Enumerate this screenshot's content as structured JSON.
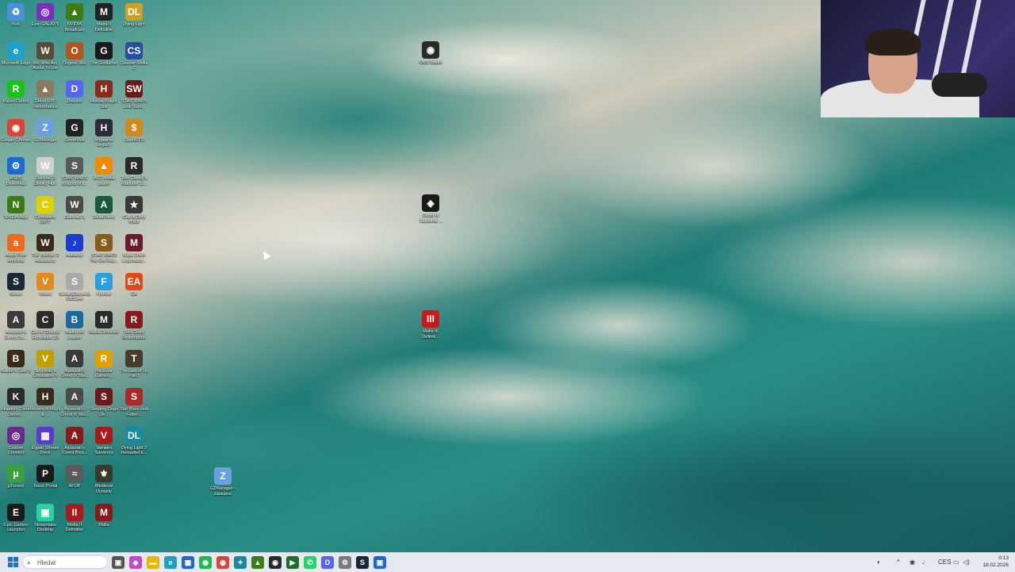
{
  "desktop_icons": [
    {
      "label": "Koš",
      "icon": "recycle-bin-icon",
      "color": "#4a90d9",
      "glyph": "♻"
    },
    {
      "label": "Epic GALAXY",
      "icon": "gog-galaxy-icon",
      "color": "#7b2fbf",
      "glyph": "◎"
    },
    {
      "label": "NVIDIA Broadcast",
      "icon": "nvidia-broadcast-icon",
      "color": "#3b7d12",
      "glyph": "▲"
    },
    {
      "label": "Mafia II Definitive",
      "icon": "mafia-icon",
      "color": "#222222",
      "glyph": "M"
    },
    {
      "label": "Dying Light",
      "icon": "dying-light-icon",
      "color": "#c9a227",
      "glyph": "DL"
    },
    {
      "label": "Microsoft Edge",
      "icon": "edge-icon",
      "color": "#1fa0c8",
      "glyph": "e"
    },
    {
      "label": "We Who Are About To Die",
      "icon": "game-icon",
      "color": "#5a4a3a",
      "glyph": "W"
    },
    {
      "label": "Original War",
      "icon": "original-war-icon",
      "color": "#b5541c",
      "glyph": "O"
    },
    {
      "label": "The Godfather",
      "icon": "godfather-icon",
      "color": "#1a1a1a",
      "glyph": "G"
    },
    {
      "label": "Counter-Strike 2",
      "icon": "cs2-icon",
      "color": "#2a4fa0",
      "glyph": "CS"
    },
    {
      "label": "Razer Cortex",
      "icon": "razer-cortex-icon",
      "color": "#19c31b",
      "glyph": "R"
    },
    {
      "label": "Ghost EPF Performance",
      "icon": "game-icon",
      "color": "#8a7a60",
      "glyph": "▲"
    },
    {
      "label": "Discord",
      "icon": "discord-icon",
      "color": "#5865f2",
      "glyph": "D"
    },
    {
      "label": "Hollow Knight Silk",
      "icon": "game-icon",
      "color": "#8a2a1a",
      "glyph": "H"
    },
    {
      "label": "STAR WARS Jedi Surv...",
      "icon": "star-wars-icon",
      "color": "#6a1a1a",
      "glyph": "SW"
    },
    {
      "label": "Google Chrome",
      "icon": "chrome-icon",
      "color": "#db4437",
      "glyph": "◉"
    },
    {
      "label": "GZManager",
      "icon": "gzmanager-icon",
      "color": "#6aa0e0",
      "glyph": "Z"
    },
    {
      "label": "GeeerHub",
      "icon": "game-icon",
      "color": "#222222",
      "glyph": "G"
    },
    {
      "label": "Hogwarts Legacy",
      "icon": "hogwarts-icon",
      "color": "#2a2a3a",
      "glyph": "H"
    },
    {
      "label": "OpenRTD",
      "icon": "openttd-icon",
      "color": "#d08a20",
      "glyph": "$"
    },
    {
      "label": "ASUS DriverHub",
      "icon": "asus-icon",
      "color": "#1a6ad0",
      "glyph": "⚙"
    },
    {
      "label": "Zaklínač 3 Divoký Hon",
      "icon": "witcher-icon",
      "color": "#d0d0d0",
      "glyph": "W"
    },
    {
      "label": "STAR WARS Knights of t...",
      "icon": "star-wars-icon",
      "color": "#5a5a5a",
      "glyph": "S"
    },
    {
      "label": "VLC media player",
      "icon": "vlc-icon",
      "color": "#f08a00",
      "glyph": "▲"
    },
    {
      "label": "Tom Clancy's Rainbow Si...",
      "icon": "rainbow-six-icon",
      "color": "#2a2a2a",
      "glyph": "R"
    },
    {
      "label": "NVIDIA App",
      "icon": "nvidia-icon",
      "color": "#3b7d12",
      "glyph": "N"
    },
    {
      "label": "Cyberpunk 2077",
      "icon": "cyberpunk-icon",
      "color": "#e0d000",
      "glyph": "C"
    },
    {
      "label": "Zaklínač 1",
      "icon": "witcher-icon",
      "color": "#4a4a4a",
      "glyph": "W"
    },
    {
      "label": "DeltaForce",
      "icon": "delta-force-icon",
      "color": "#1a5a3a",
      "glyph": "A"
    },
    {
      "label": "Call of Duty WWII",
      "icon": "cod-icon",
      "color": "#3a3a3a",
      "glyph": "★"
    },
    {
      "label": "Avast Free Antivirus",
      "icon": "avast-icon",
      "color": "#f06a1a",
      "glyph": "a"
    },
    {
      "label": "The Witcher 2 Assassins",
      "icon": "witcher-icon",
      "color": "#3a2a1a",
      "glyph": "W"
    },
    {
      "label": "Audacity",
      "icon": "audacity-icon",
      "color": "#1a3ad0",
      "glyph": "♪"
    },
    {
      "label": "STAR WARS The Old Rep...",
      "icon": "star-wars-icon",
      "color": "#8a5a1a",
      "glyph": "S"
    },
    {
      "label": "Mass Effect Legendary...",
      "icon": "mass-effect-icon",
      "color": "#6a1a2a",
      "glyph": "M"
    },
    {
      "label": "Steam",
      "icon": "steam-icon",
      "color": "#1b2838",
      "glyph": "S"
    },
    {
      "label": "Vortex",
      "icon": "vortex-icon",
      "color": "#e08a20",
      "glyph": "V"
    },
    {
      "label": "StreamElements OBS.live",
      "icon": "streamelements-icon",
      "color": "#aaaaaa",
      "glyph": "S"
    },
    {
      "label": "Fortnite",
      "icon": "fortnite-icon",
      "color": "#2aa0e0",
      "glyph": "F"
    },
    {
      "label": "EA",
      "icon": "ea-icon",
      "color": "#e04a1a",
      "glyph": "EA"
    },
    {
      "label": "Assassin's Creed Ori...",
      "icon": "assassins-creed-icon",
      "color": "#3a3a3a",
      "glyph": "A"
    },
    {
      "label": "Call of Cthulhu Expedition 33",
      "icon": "game-icon",
      "color": "#2a2a2a",
      "glyph": "C"
    },
    {
      "label": "Battle.net Loader",
      "icon": "battlenet-icon",
      "color": "#1a6aa0",
      "glyph": "B"
    },
    {
      "label": "Mafia Definitive",
      "icon": "mafia-icon",
      "color": "#2a2a2a",
      "glyph": "M"
    },
    {
      "label": "Red Dead Redemption",
      "icon": "rdr-icon",
      "color": "#8a1a1a",
      "glyph": "R"
    },
    {
      "label": "Baldur's Gate 3",
      "icon": "baldurs-gate-icon",
      "color": "#3a2a1a",
      "glyph": "B"
    },
    {
      "label": "Sid Meier's Civilization V",
      "icon": "civilization-icon",
      "color": "#c0a000",
      "glyph": "V"
    },
    {
      "label": "Assassin's Creed IV Bla...",
      "icon": "assassins-creed-icon",
      "color": "#3a3a3a",
      "glyph": "A"
    },
    {
      "label": "Rockstar Games...",
      "icon": "rockstar-icon",
      "color": "#e0a000",
      "glyph": "R"
    },
    {
      "label": "The Last of Us Part I",
      "icon": "last-of-us-icon",
      "color": "#4a3a2a",
      "glyph": "T"
    },
    {
      "label": "Kingdom Come Delive...",
      "icon": "kingdom-come-icon",
      "color": "#2a2a2a",
      "glyph": "K"
    },
    {
      "label": "Heroes of Might & ...",
      "icon": "heroes-icon",
      "color": "#3a2a1a",
      "glyph": "H"
    },
    {
      "label": "Assassin's Creed IV Bla...",
      "icon": "assassins-creed-icon",
      "color": "#4a4a4a",
      "glyph": "A"
    },
    {
      "label": "Sleeping Dogs De...",
      "icon": "sleeping-dogs-icon",
      "color": "#6a1a1a",
      "glyph": "S"
    },
    {
      "label": "Star Wars Jedi Fallen...",
      "icon": "star-wars-icon",
      "color": "#aa2a2a",
      "glyph": "S"
    },
    {
      "label": "Custom Connect",
      "icon": "connect-icon",
      "color": "#6a2a8a",
      "glyph": "◎"
    },
    {
      "label": "Elgato Stream Deck",
      "icon": "stream-deck-icon",
      "color": "#5a3ad0",
      "glyph": "▦"
    },
    {
      "label": "Assassin's Creed Brot...",
      "icon": "assassins-creed-icon",
      "color": "#8a1a1a",
      "glyph": "A"
    },
    {
      "label": "Vampire Survivors",
      "icon": "vampire-survivors-icon",
      "color": "#aa1a1a",
      "glyph": "V"
    },
    {
      "label": "Dying Light 2 Reloaded E...",
      "icon": "dying-light-icon",
      "color": "#1a8aa0",
      "glyph": "DL"
    },
    {
      "label": "µTorrent",
      "icon": "utorrent-icon",
      "color": "#3aa03a",
      "glyph": "µ"
    },
    {
      "label": "Touch Portal",
      "icon": "touch-portal-icon",
      "color": "#1a1a1a",
      "glyph": "P"
    },
    {
      "label": "AFOP",
      "icon": "afop-icon",
      "color": "#5a5a5a",
      "glyph": "≈"
    },
    {
      "label": "Medieval Dynasty",
      "icon": "medieval-dynasty-icon",
      "color": "#3a3a2a",
      "glyph": "⚜"
    },
    {
      "label": "",
      "icon": "blank-icon",
      "color": "#00000000",
      "glyph": ""
    },
    {
      "label": "Epic Games Launcher",
      "icon": "epic-games-icon",
      "color": "#1a1a1a",
      "glyph": "E"
    },
    {
      "label": "Streamlabs Desktop",
      "icon": "streamlabs-icon",
      "color": "#2ad0a0",
      "glyph": "▣"
    },
    {
      "label": "Mafia II Definitive",
      "icon": "mafia-icon",
      "color": "#aa1a1a",
      "glyph": "II"
    },
    {
      "label": "Mafia",
      "icon": "mafia-icon",
      "color": "#8a1a1a",
      "glyph": "M"
    }
  ],
  "loose_icons": [
    {
      "label": "OBS Studio",
      "icon": "obs-studio-icon",
      "color": "#2a2a2a",
      "glyph": "◉"
    },
    {
      "label": "Ghost of Tsushima ...",
      "icon": "ghost-of-tsushima-icon",
      "color": "#1a1a1a",
      "glyph": "◈"
    },
    {
      "label": "Mafia III Definiti...",
      "icon": "mafia-iii-icon",
      "color": "#c81a1a",
      "glyph": "III"
    },
    {
      "label": "GZManager - zástupce",
      "icon": "gzmanager-icon",
      "color": "#6aa0e0",
      "glyph": "Z"
    }
  ],
  "taskbar": {
    "search_placeholder": "Hledat",
    "apps": [
      {
        "name": "task-view",
        "color": "#555555",
        "glyph": "▣"
      },
      {
        "name": "copilot",
        "color": "#c04ad0",
        "glyph": "◆"
      },
      {
        "name": "file-explorer",
        "color": "#f0b400",
        "glyph": "▬"
      },
      {
        "name": "edge",
        "color": "#1fa0c8",
        "glyph": "e"
      },
      {
        "name": "store",
        "color": "#1a6ad0",
        "glyph": "▦"
      },
      {
        "name": "spotify",
        "color": "#1db954",
        "glyph": "◉"
      },
      {
        "name": "chrome",
        "color": "#db4437",
        "glyph": "◉"
      },
      {
        "name": "elgato",
        "color": "#1a8aa0",
        "glyph": "✦"
      },
      {
        "name": "nvidia",
        "color": "#3b7d12",
        "glyph": "▲"
      },
      {
        "name": "obs",
        "color": "#2a2a2a",
        "glyph": "◉"
      },
      {
        "name": "geforce",
        "color": "#1b6f2a",
        "glyph": "▶"
      },
      {
        "name": "whatsapp",
        "color": "#25d366",
        "glyph": "✆"
      },
      {
        "name": "discord",
        "color": "#5865f2",
        "glyph": "D"
      },
      {
        "name": "settings",
        "color": "#7a7a7a",
        "glyph": "⚙"
      },
      {
        "name": "steam",
        "color": "#1b2838",
        "glyph": "S"
      },
      {
        "name": "taskbar-extra",
        "color": "#1a6ad0",
        "glyph": "▣"
      }
    ],
    "tray": {
      "language": "CES",
      "time": "0:13",
      "date": "18.02.2026"
    }
  }
}
